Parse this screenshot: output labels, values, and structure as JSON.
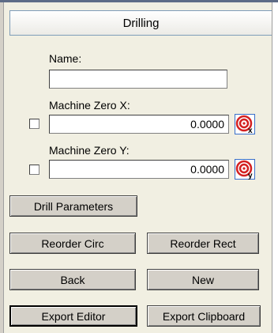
{
  "panel": {
    "title": "Drilling"
  },
  "name_field": {
    "label": "Name:",
    "value": ""
  },
  "machine_zero_x": {
    "label": "Machine Zero X:",
    "value": "0.0000",
    "icon": "target-x-icon"
  },
  "machine_zero_y": {
    "label": "Machine Zero Y:",
    "value": "0.0000",
    "icon": "target-y-icon"
  },
  "buttons": {
    "drill_parameters": "Drill Parameters",
    "reorder_circ": "Reorder Circ",
    "reorder_rect": "Reorder Rect",
    "back": "Back",
    "new": "New",
    "export_editor": "Export Editor",
    "export_clipboard": "Export Clipboard"
  },
  "colors": {
    "icon_red": "#d42020",
    "panel_bg": "#f1efe2",
    "button_face": "#d4d0c8"
  }
}
